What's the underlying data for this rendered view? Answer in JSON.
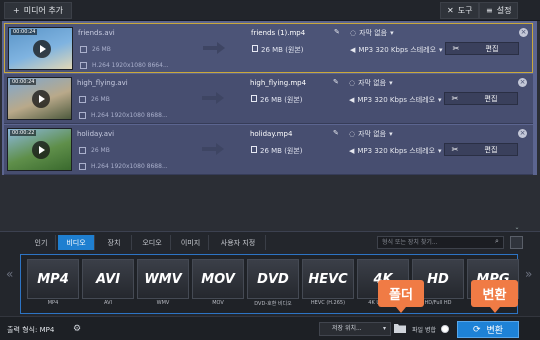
{
  "toolbar": {
    "add_media_label": "미디어 추가",
    "tools_label": "도구",
    "settings_label": "설정"
  },
  "files": [
    {
      "duration": "00:00:24",
      "source_name": "friends.avi",
      "source_size": "26 MB",
      "source_info": "H.264 1920x1080 8664...",
      "output_name": "friends (1).mp4",
      "output_size": "26 MB (원본)",
      "subtitle": "자막 없음",
      "audio": "MP3 320 Kbps 스테레오",
      "edit_label": "편집",
      "selected": true,
      "thumb_colors": [
        "#5b95c8",
        "#7fb3e0",
        "#e2d8b6"
      ]
    },
    {
      "duration": "00:00:24",
      "source_name": "high_flying.avi",
      "source_size": "26 MB",
      "source_info": "H.264 1920x1080 8688...",
      "output_name": "high_flying.mp4",
      "output_size": "26 MB (원본)",
      "subtitle": "자막 없음",
      "audio": "MP3 320 Kbps 스테레오",
      "edit_label": "편집",
      "selected": false,
      "thumb_colors": [
        "#7ea8d0",
        "#b9a98a",
        "#4d5a3e"
      ]
    },
    {
      "duration": "00:00:22",
      "source_name": "holiday.avi",
      "source_size": "26 MB",
      "source_info": "H.264 1920x1080 8688...",
      "output_name": "holiday.mp4",
      "output_size": "26 MB (원본)",
      "subtitle": "자막 없음",
      "audio": "MP3 320 Kbps 스테레오",
      "edit_label": "편집",
      "selected": false,
      "thumb_colors": [
        "#8cb8dd",
        "#5f8f4a",
        "#3a6a2e"
      ]
    }
  ],
  "tabs": [
    {
      "label": "인기",
      "active": false
    },
    {
      "label": "비디오",
      "active": true
    },
    {
      "label": "장치",
      "active": false
    },
    {
      "label": "오디오",
      "active": false
    },
    {
      "label": "이미지",
      "active": false
    },
    {
      "label": "사용자 지정",
      "active": false
    }
  ],
  "format_search": {
    "placeholder": "형식 또는 장치 찾기..."
  },
  "formats": [
    {
      "logo": "MP4",
      "caption": "MP4"
    },
    {
      "logo": "AVI",
      "caption": "AVI"
    },
    {
      "logo": "WMV",
      "caption": "WMV"
    },
    {
      "logo": "MOV",
      "caption": "MOV"
    },
    {
      "logo": "DVD",
      "caption": "DVD-호환 비디오"
    },
    {
      "logo": "HEVC",
      "caption": "HEVC (H.265)"
    },
    {
      "logo": "4K",
      "caption": "4K Ultra HD"
    },
    {
      "logo": "HD",
      "caption": "HD/Full HD"
    },
    {
      "logo": "MPG",
      "caption": "MPG"
    }
  ],
  "bottom": {
    "output_format_label": "출력 형식: MP4",
    "save_to_label": "저장 위치...",
    "merge_label": "파일 병합",
    "convert_label": "변환"
  },
  "callouts": {
    "folder": "폴더",
    "convert": "변환"
  },
  "colors": {
    "accent": "#1e82d6",
    "callout": "#f07b45",
    "selected_border": "#c9a93b"
  }
}
